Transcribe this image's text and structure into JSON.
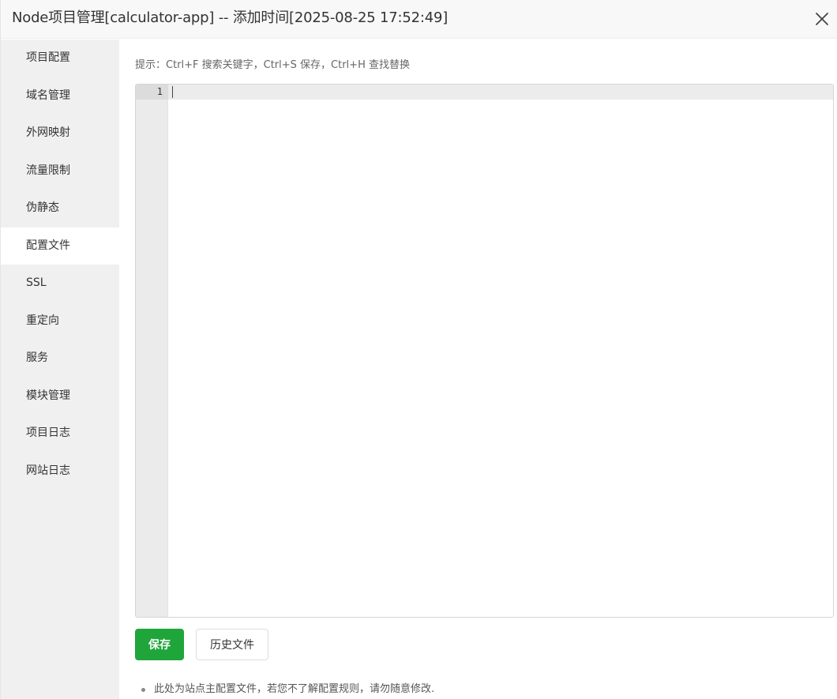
{
  "dialog": {
    "title": "Node项目管理[calculator-app] -- 添加时间[2025-08-25 17:52:49]",
    "close_icon": "close-icon"
  },
  "sidebar": {
    "items": [
      {
        "label": "项目配置",
        "active": false
      },
      {
        "label": "域名管理",
        "active": false
      },
      {
        "label": "外网映射",
        "active": false
      },
      {
        "label": "流量限制",
        "active": false
      },
      {
        "label": "伪静态",
        "active": false
      },
      {
        "label": "配置文件",
        "active": true
      },
      {
        "label": "SSL",
        "active": false
      },
      {
        "label": "重定向",
        "active": false
      },
      {
        "label": "服务",
        "active": false
      },
      {
        "label": "模块管理",
        "active": false
      },
      {
        "label": "项目日志",
        "active": false
      },
      {
        "label": "网站日志",
        "active": false
      }
    ]
  },
  "main": {
    "hint": "提示：Ctrl+F 搜索关键字，Ctrl+S 保存，Ctrl+H 查找替换",
    "editor": {
      "line_numbers": [
        "1"
      ],
      "content": ""
    },
    "save_label": "保存",
    "history_label": "历史文件",
    "notes": [
      "此处为站点主配置文件，若您不了解配置规则，请勿随意修改."
    ]
  },
  "colors": {
    "accent": "#20a53a",
    "sidebar_bg": "#f0f0f0",
    "titlebar_bg": "#f8f8f8"
  }
}
